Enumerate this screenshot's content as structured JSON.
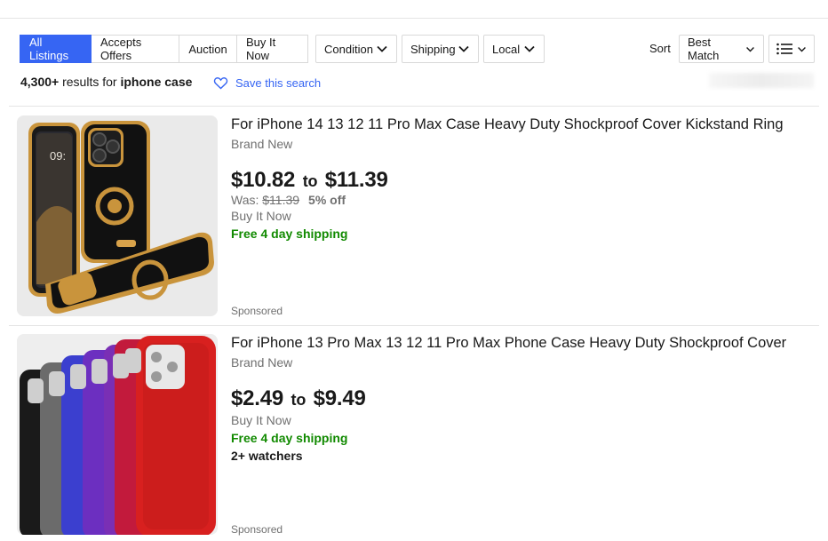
{
  "filters": {
    "tabs": [
      "All Listings",
      "Accepts Offers",
      "Auction",
      "Buy It Now"
    ],
    "dropdowns": [
      "Condition",
      "Shipping",
      "Local"
    ],
    "sort_label": "Sort",
    "sort_value": "Best Match",
    "view_icon": "list-view-icon"
  },
  "results": {
    "count": "4,300+",
    "mid": " results for ",
    "query": "iphone case"
  },
  "save_search": {
    "label": "Save this search",
    "icon": "heart-icon"
  },
  "listings": [
    {
      "title": "For iPhone 14 13 12 11 Pro Max Case Heavy Duty Shockproof Cover Kickstand Ring",
      "condition": "Brand New",
      "price_low": "$10.82",
      "price_to": "to",
      "price_high": "$11.39",
      "was_label": "Was: ",
      "was_price": "$11.39",
      "discount": "5% off",
      "format": "Buy It Now",
      "shipping": "Free 4 day shipping",
      "sponsored": "Sponsored"
    },
    {
      "title": "For iPhone 13 Pro Max 13 12 11 Pro Max Phone Case Heavy Duty Shockproof Cover",
      "condition": "Brand New",
      "price_low": "$2.49",
      "price_to": "to",
      "price_high": "$9.49",
      "format": "Buy It Now",
      "shipping": "Free 4 day shipping",
      "watchers": "2+ watchers",
      "sponsored": "Sponsored"
    }
  ],
  "colors": {
    "accent": "#3665f3",
    "shipping_green": "#118a00",
    "muted": "#707070",
    "case1_body": "#141414",
    "case1_gold": "#c9943c",
    "case2_colors": [
      "#1a1a1a",
      "#6b6b6b",
      "#3b3fcf",
      "#6c2fc0",
      "#7a2fb5",
      "#c21a3c",
      "#d8201f"
    ]
  }
}
